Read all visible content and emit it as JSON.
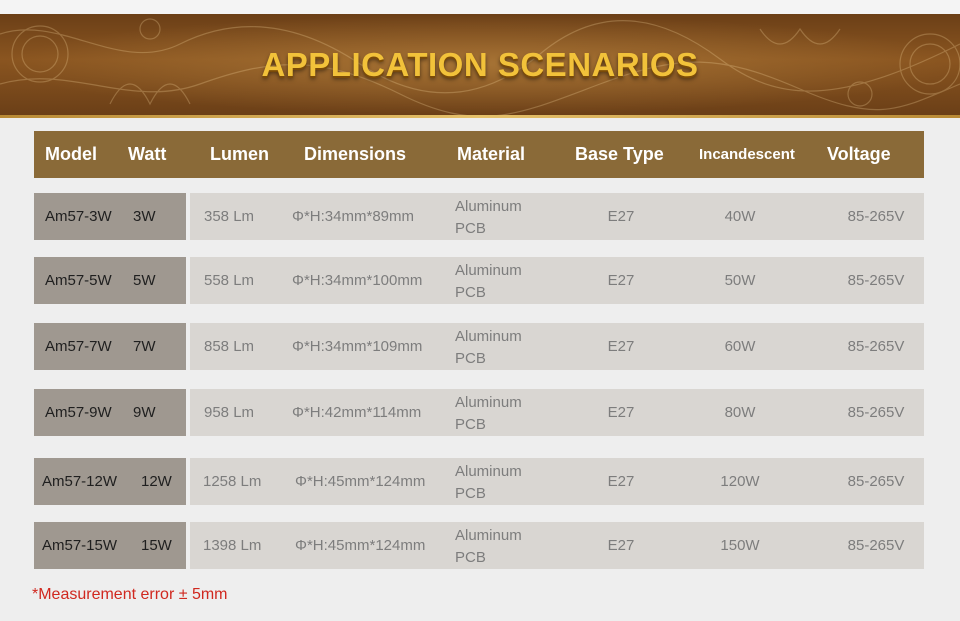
{
  "banner": {
    "title": "APPLICATION SCENARIOS"
  },
  "table": {
    "headers": [
      "Model",
      "Watt",
      "Lumen",
      "Dimensions",
      "Material",
      "Base Type",
      "Incandescent",
      "Voltage"
    ],
    "rows": [
      {
        "model": "Am57-3W",
        "watt": "3W",
        "lumen": "358 Lm",
        "dimensions": "Φ*H:34mm*89mm",
        "material_line1": "Aluminum",
        "material_line2": "PCB",
        "base": "E27",
        "incandescent": "40W",
        "voltage": "85-265V"
      },
      {
        "model": "Am57-5W",
        "watt": "5W",
        "lumen": "558 Lm",
        "dimensions": "Φ*H:34mm*100mm",
        "material_line1": "Aluminum",
        "material_line2": "PCB",
        "base": "E27",
        "incandescent": "50W",
        "voltage": "85-265V"
      },
      {
        "model": "Am57-7W",
        "watt": "7W",
        "lumen": "858 Lm",
        "dimensions": "Φ*H:34mm*109mm",
        "material_line1": "Aluminum",
        "material_line2": "PCB",
        "base": "E27",
        "incandescent": "60W",
        "voltage": "85-265V"
      },
      {
        "model": "Am57-9W",
        "watt": "9W",
        "lumen": "958 Lm",
        "dimensions": "Φ*H:42mm*114mm",
        "material_line1": "Aluminum",
        "material_line2": "PCB",
        "base": "E27",
        "incandescent": "80W",
        "voltage": "85-265V"
      },
      {
        "model": "Am57-12W",
        "watt": "12W",
        "lumen": "1258 Lm",
        "dimensions": "Φ*H:45mm*124mm",
        "material_line1": "Aluminum",
        "material_line2": "PCB",
        "base": "E27",
        "incandescent": "120W",
        "voltage": "85-265V"
      },
      {
        "model": "Am57-15W",
        "watt": "15W",
        "lumen": "1398 Lm",
        "dimensions": "Φ*H:45mm*124mm",
        "material_line1": "Aluminum",
        "material_line2": "PCB",
        "base": "E27",
        "incandescent": "150W",
        "voltage": "85-265V"
      }
    ]
  },
  "note": "*Measurement error ± 5mm",
  "colors": {
    "banner_brown": "#7a4a1c",
    "title_gold": "#f2c23a",
    "header_bg": "#8a6a38",
    "model_cell_bg": "#9f9890",
    "data_cell_bg": "#d9d6d2",
    "note_red": "#d0281f"
  }
}
